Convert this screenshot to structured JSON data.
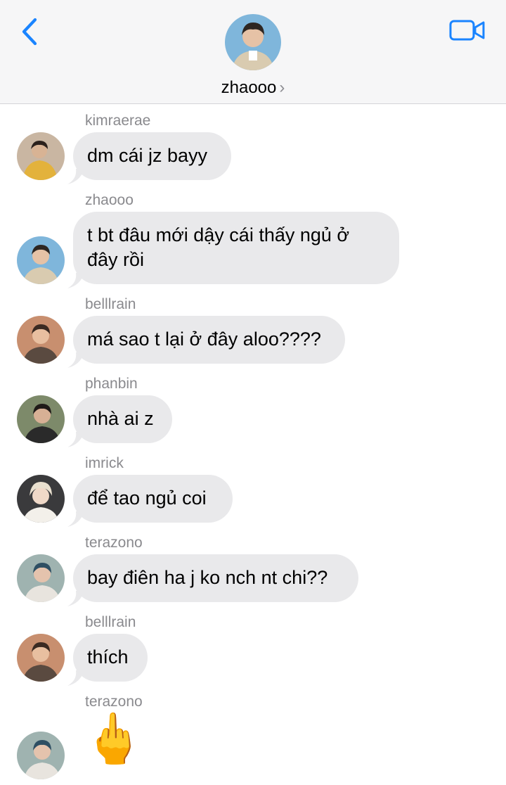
{
  "header": {
    "contact_name": "zhaooo",
    "chevron": "›",
    "back_icon": "chevron-left-icon",
    "video_icon": "video-camera-icon",
    "accent_color": "#1a84ff"
  },
  "messages": [
    {
      "sender": "kimraerae",
      "text": "dm cái jz bayy"
    },
    {
      "sender": "zhaooo",
      "text_lines": [
        "t bt đâu mới dậy cái thấy ngủ ở",
        "đây rồi"
      ]
    },
    {
      "sender": "belllrain",
      "text": "má sao t lại ở đây aloo????"
    },
    {
      "sender": "phanbin",
      "text": "nhà ai z"
    },
    {
      "sender": "imrick",
      "text": "để tao ngủ coi"
    },
    {
      "sender": "terazono",
      "text": "bay điên ha j ko nch nt chi??"
    },
    {
      "sender": "belllrain",
      "text": "thích"
    },
    {
      "sender": "terazono",
      "emoji": "🖕"
    }
  ]
}
